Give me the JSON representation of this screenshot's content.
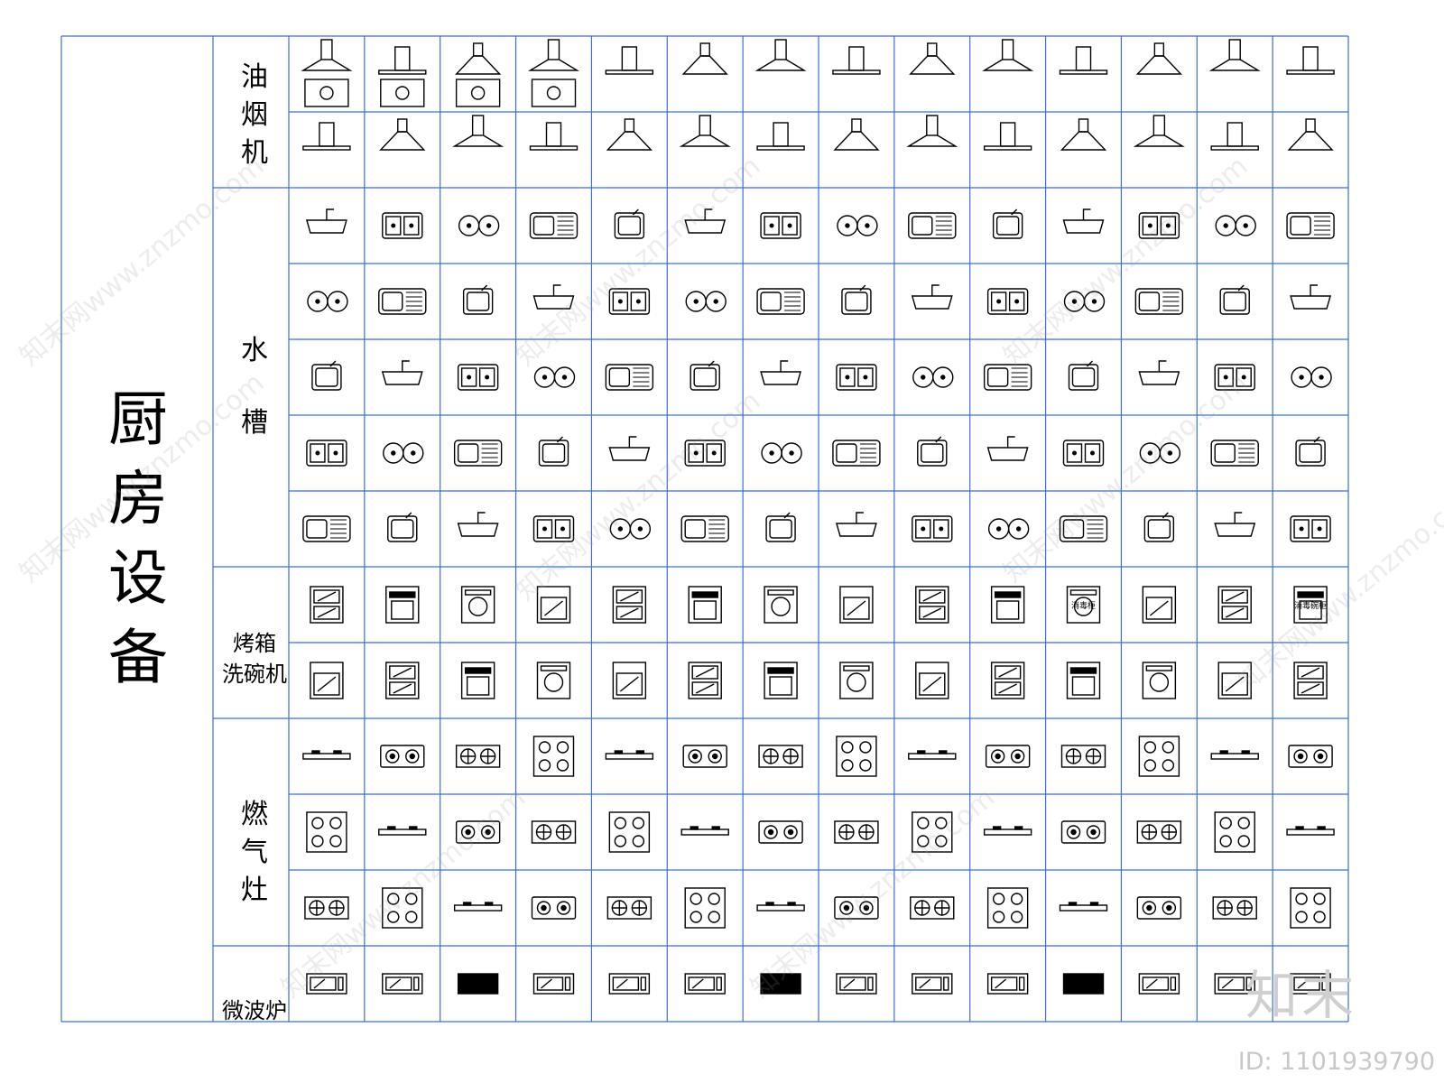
{
  "title": "厨房设备",
  "grid_color": "#3b6fd6",
  "categories": [
    {
      "id": "range-hood",
      "label": "油烟机",
      "rows": 2,
      "icons": [
        "range-hood-icon"
      ]
    },
    {
      "id": "sink",
      "label": "水槽",
      "rows": 5,
      "icons": [
        "sink-icon"
      ]
    },
    {
      "id": "oven-dishwasher",
      "label_lines": [
        "烤箱",
        "洗碗机"
      ],
      "rows": 2,
      "icons": [
        "oven-icon"
      ]
    },
    {
      "id": "gas-stove",
      "label": "燃气灶",
      "rows": 3,
      "icons": [
        "gas-stove-icon"
      ]
    },
    {
      "id": "microwave",
      "label": "微波炉",
      "rows": 1,
      "icons": [
        "microwave-icon"
      ]
    }
  ],
  "cell_labels": {
    "disinfection_cabinet_a": "消毒柜",
    "disinfection_cabinet_b": "消毒碗柜"
  },
  "watermark": {
    "logo": "知末",
    "id_text": "ID: 1101939790",
    "repeat_text": "知末网www.znzmo.com"
  }
}
